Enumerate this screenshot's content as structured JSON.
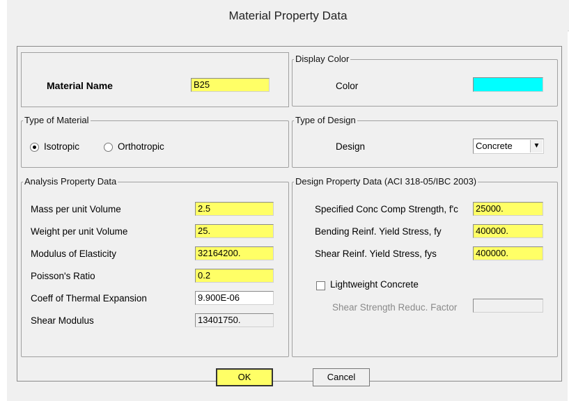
{
  "window": {
    "title": "Material Property Data"
  },
  "material_name": {
    "label": "Material Name",
    "value": "B25"
  },
  "display_color": {
    "group": "Display Color",
    "label": "Color",
    "swatch": "#00ffff"
  },
  "type_of_material": {
    "group": "Type of Material",
    "options": [
      "Isotropic",
      "Orthotropic"
    ],
    "selected": "Isotropic"
  },
  "type_of_design": {
    "group": "Type of Design",
    "label": "Design",
    "value": "Concrete"
  },
  "analysis": {
    "group": "Analysis Property Data",
    "rows": [
      {
        "label": "Mass per unit Volume",
        "value": "2.5"
      },
      {
        "label": "Weight per unit Volume",
        "value": "25."
      },
      {
        "label": "Modulus of Elasticity",
        "value": "32164200."
      },
      {
        "label": "Poisson's Ratio",
        "value": "0.2"
      },
      {
        "label": "Coeff of Thermal Expansion",
        "value": "9.900E-06"
      },
      {
        "label": "Shear Modulus",
        "value": "13401750."
      }
    ]
  },
  "design_props": {
    "group": "Design Property Data (ACI 318-05/IBC 2003)",
    "rows": [
      {
        "label": "Specified Conc Comp Strength, f'c",
        "value": "25000."
      },
      {
        "label": "Bending Reinf. Yield Stress, fy",
        "value": "400000."
      },
      {
        "label": "Shear Reinf. Yield Stress, fys",
        "value": "400000."
      }
    ],
    "lightweight_label": "Lightweight Concrete",
    "lightweight_checked": false,
    "shear_reduc_label": "Shear Strength Reduc. Factor",
    "shear_reduc_value": ""
  },
  "buttons": {
    "ok": "OK",
    "cancel": "Cancel"
  },
  "colors": {
    "highlight": "#ffff66",
    "background": "#f0f0f0"
  }
}
